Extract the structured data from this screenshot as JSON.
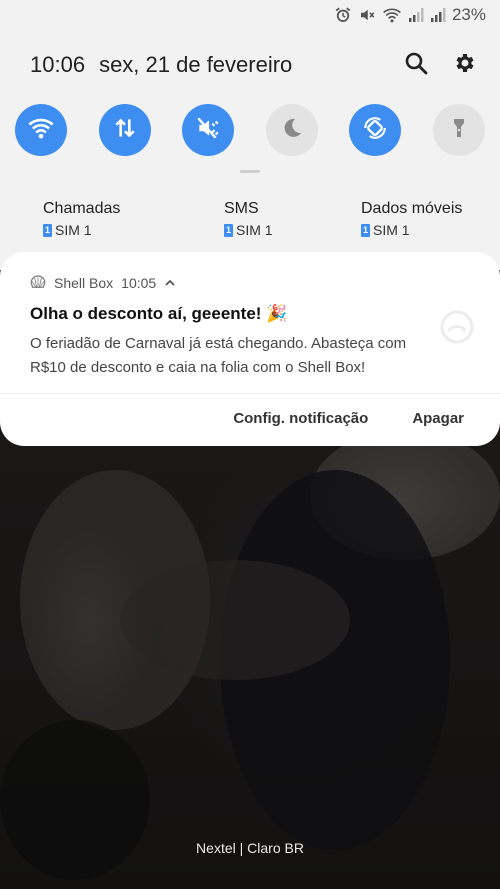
{
  "status": {
    "battery": "23%"
  },
  "header": {
    "time": "10:06",
    "date": "sex, 21 de fevereiro"
  },
  "quick_toggles": [
    {
      "name": "wifi",
      "on": true
    },
    {
      "name": "mobile-data",
      "on": true
    },
    {
      "name": "sound-mute",
      "on": true
    },
    {
      "name": "blue-light",
      "on": false
    },
    {
      "name": "auto-rotate",
      "on": true
    },
    {
      "name": "flashlight",
      "on": false
    }
  ],
  "sims": [
    {
      "label": "Chamadas",
      "sim": "SIM 1",
      "badge": "1"
    },
    {
      "label": "SMS",
      "sim": "SIM 1",
      "badge": "1"
    },
    {
      "label": "Dados móveis",
      "sim": "SIM 1",
      "badge": "1"
    }
  ],
  "notification": {
    "app": "Shell Box",
    "time": "10:05",
    "title": "Olha o desconto aí, geeente! 🎉",
    "body": "O feriadão de Carnaval já está chegando. Abasteça com R$10 de desconto e caia na folia com o Shell Box!",
    "actions": {
      "settings": "Config. notificação",
      "clear": "Apagar"
    }
  },
  "carrier": "Nextel | Claro BR",
  "colors": {
    "accent": "#3d8ef0",
    "panel_bg": "#f2f2f2"
  }
}
